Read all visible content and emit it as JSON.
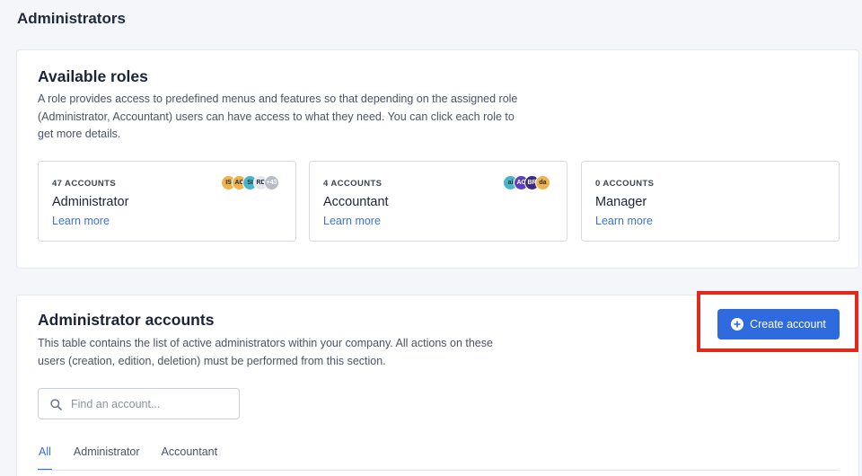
{
  "header": {
    "title": "Administrators"
  },
  "roles_section": {
    "title": "Available roles",
    "description": "A role provides access to predefined menus and features so that depending on the assigned role (Administrator, Accountant) users can have access to what they need. You can click each role to get more details.",
    "roles": [
      {
        "count": "47 ACCOUNTS",
        "name": "Administrator",
        "link": "Learn more",
        "avatars": [
          {
            "initials": "IS",
            "color": "#f0b24a"
          },
          {
            "initials": "AC",
            "color": "#f0b24a"
          },
          {
            "initials": "SI",
            "color": "#48b5c9"
          },
          {
            "initials": "RD",
            "color": "#e4e7ec"
          },
          {
            "initials": "+43",
            "color": "#b7bcc6"
          }
        ]
      },
      {
        "count": "4 ACCOUNTS",
        "name": "Accountant",
        "link": "Learn more",
        "avatars": [
          {
            "initials": "ai",
            "color": "#48b5c9"
          },
          {
            "initials": "AC",
            "color": "#5b3fc4"
          },
          {
            "initials": "BR",
            "color": "#3b2a8a"
          },
          {
            "initials": "da",
            "color": "#f0b24a"
          }
        ]
      },
      {
        "count": "0 ACCOUNTS",
        "name": "Manager",
        "link": "Learn more",
        "avatars": []
      }
    ]
  },
  "accounts_section": {
    "title": "Administrator accounts",
    "description": "This table contains the list of active administrators within your company. All actions on these users (creation, edition, deletion) must be performed from this section.",
    "create_button": "Create account",
    "search": {
      "placeholder": "Find an account..."
    },
    "tabs": [
      {
        "label": "All",
        "active": true
      },
      {
        "label": "Administrator",
        "active": false
      },
      {
        "label": "Accountant",
        "active": false
      }
    ]
  },
  "colors": {
    "accent": "#2f6bde",
    "highlight": "#e02a1c"
  }
}
